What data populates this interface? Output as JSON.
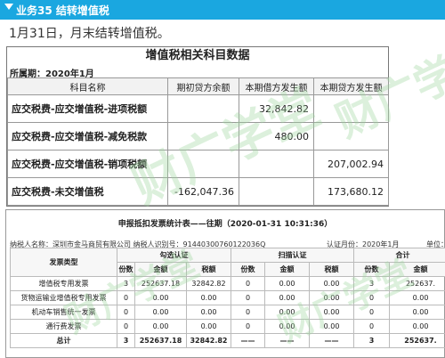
{
  "titlebar": {
    "label": "业务35 结转增值税"
  },
  "instruction": "1月31日，月末结转增值税。",
  "summary": {
    "title": "增值税相关科目数据",
    "period": "所属期：2020年1月",
    "headers": [
      "科目名称",
      "期初贷方余额",
      "本期借方发生额",
      "本期贷方发生额"
    ],
    "rows": [
      [
        "应交税费-应交增值税-进项税额",
        "",
        "32,842.82",
        ""
      ],
      [
        "应交税费-应交增值税-减免税款",
        "",
        "480.00",
        ""
      ],
      [
        "应交税费-应交增值税-销项税额",
        "",
        "",
        "207,002.94"
      ],
      [
        "应交税费-未交增值税",
        "-162,047.36",
        "",
        "173,680.12"
      ]
    ]
  },
  "report": {
    "title": "申报抵扣发票统计表——往期（2020-01-31 10:31:36）",
    "taxpayer": "纳税人名称：深圳市金马商贸有限公司 纳税人识别号：91440300760122036Q",
    "period": "认证月份：2020年1月",
    "unit": "单位：",
    "col_group": [
      "发票类型",
      "勾选认证",
      "扫描认证",
      "合计"
    ],
    "sub_headers": [
      "份数",
      "金额",
      "税额",
      "份数",
      "金额",
      "税额",
      "份数",
      "金额"
    ],
    "rows": [
      [
        "增值税专用发票",
        "3",
        "252637.18",
        "32842.82",
        "0",
        "0.00",
        "0.00",
        "3",
        "252637."
      ],
      [
        "货物运输业增值税专用发票",
        "0",
        "0.00",
        "0.00",
        "0",
        "0.00",
        "0.00",
        "0",
        "0.00"
      ],
      [
        "机动车销售统一发票",
        "0",
        "0.00",
        "0.00",
        "0",
        "0.00",
        "0.00",
        "0",
        "0.00"
      ],
      [
        "通行费发票",
        "0",
        "0.00",
        "0.00",
        "0",
        "0.00",
        "0.00",
        "0",
        "0.00"
      ]
    ],
    "total": [
      "总计",
      "3",
      "252637.18",
      "32842.82",
      "——",
      "——",
      "——",
      "3",
      "252637."
    ]
  },
  "watermark": {
    "text": "财广学堂",
    "color": "#9ed79e"
  },
  "colors": {
    "titlebar": "#1aa7e0"
  }
}
